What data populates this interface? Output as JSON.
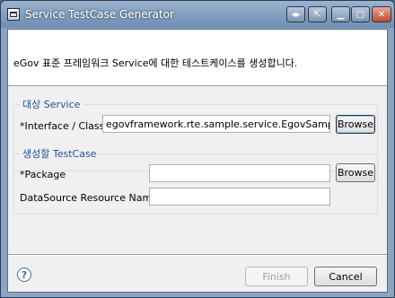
{
  "window": {
    "title": "Service TestCase Generator"
  },
  "titlebar_buttons": {
    "swap_icon": "arrows-lr-icon",
    "restore_icon": "restore-icon",
    "minimize_icon": "minimize-icon",
    "maximize_icon": "maximize-icon",
    "close_icon": "close-icon"
  },
  "header": {
    "description": "eGov 표준 프레임워크 Service에 대한 테스트케이스를 생성합니다."
  },
  "target_group": {
    "title": "대상 Service",
    "interface_label": "*Interface / Class",
    "interface_value": "egovframework.rte.sample.service.EgovSampleServic",
    "browse_label": "Browse"
  },
  "testcase_group": {
    "title": "생성할 TestCase",
    "package_label": "*Package",
    "package_value": "",
    "browse_label": "Browse",
    "datasource_label": "DataSource Resource Name",
    "datasource_value": ""
  },
  "footer": {
    "help_symbol": "?",
    "finish_label": "Finish",
    "cancel_label": "Cancel"
  }
}
